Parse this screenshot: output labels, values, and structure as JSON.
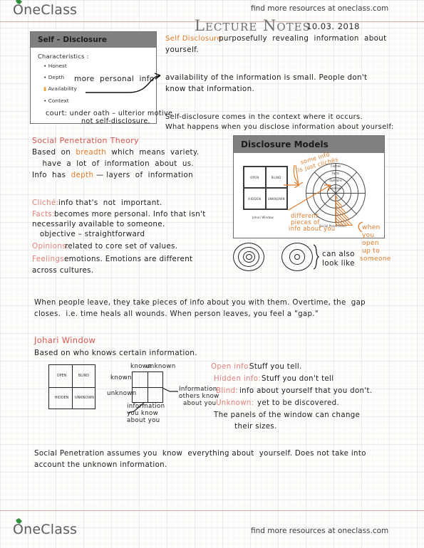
{
  "brand": {
    "name": "OneClass",
    "tagline": "find more resources at oneclass.com"
  },
  "header": {
    "title": "Lecture Notes",
    "date": "10.03. 2018"
  },
  "slides": [
    {
      "id": "self-disclosure",
      "title": "Self – Disclosure",
      "bullets": [
        "Characteristics :",
        "Honest",
        "Depth",
        "Availability",
        "Context"
      ],
      "annotations": [
        "more  personal  info",
        "court: under oath – ulterior motive",
        "not self-disclosure."
      ]
    },
    {
      "id": "disclosure-models",
      "title": "Disclosure Models",
      "johari": {
        "caption": "Johari Window",
        "cells": [
          "OPEN",
          "BLIND",
          "HIDDEN",
          "UNKNOWN"
        ]
      },
      "wheel": {
        "caption": "Social Penetration",
        "rings": [
          "Clichés",
          "Facts",
          "Opinions",
          "Feelings"
        ]
      },
      "annotations": [
        "some info",
        "is just clichés",
        "different",
        "pieces of",
        "info about you",
        "when",
        "you",
        "open",
        "up to",
        "someone"
      ]
    }
  ],
  "notes": {
    "col_right_top": [
      "Self Disclosure: purposefully revealing information about",
      "yourself."
    ],
    "availability": [
      "availability of the information is small. People don't",
      "know that information."
    ],
    "context": [
      "Self-disclosure comes in the context where it occurs.",
      "What happens when you disclose information about yourself:"
    ],
    "social_penetration": {
      "heading": "Social Penetration Theory",
      "lines": [
        "Based on breadth which means variety.",
        "   have a lot of information about us.",
        "Info has depth – layers of information"
      ],
      "highlight_breadth": "breadth",
      "highlight_depth": "depth"
    },
    "layers": [
      {
        "label": "Cliché:",
        "text": "info that's  not  important."
      },
      {
        "label": "Facts:",
        "text": "becomes more personal. Info that isn't"
      },
      {
        "label": "",
        "text": "necessarily available to someone."
      },
      {
        "label": "",
        "text": "   objective – straightforward"
      },
      {
        "label": "Opinions:",
        "text": "related to core set of values."
      },
      {
        "label": "Feelings:",
        "text": "emotions. Emotions are different"
      },
      {
        "label": "",
        "text": "across cultures."
      }
    ],
    "diagram_note": [
      "can also",
      "look like"
    ],
    "gap_paragraph": [
      "When people leave, they take pieces of info about you with them. Overtime, the  gap",
      "closes.  i.e. time heals all wounds. When person leaves, you feel a \"gap.\""
    ],
    "johari_section": {
      "heading": "Johari Window",
      "subheading": "Based on who knows certain information.",
      "drawing_labels": {
        "top_left": "known",
        "top_right": "unknown",
        "left_top": "known",
        "left_bottom": "unknown",
        "note_right": [
          "Information",
          "others know",
          "about you"
        ],
        "note_bottom": [
          "information",
          "you know",
          "about you"
        ]
      },
      "definitions": [
        {
          "label": "Open info:",
          "text": "Stuff you tell."
        },
        {
          "label": "Hidden info:",
          "text": "Stuff you don't tell"
        },
        {
          "label": "Blind:",
          "text": "info about yourself that you don't."
        },
        {
          "label": "Unknown:",
          "text": "yet to be discovered."
        }
      ],
      "closing": [
        "The panels of the window can change",
        "  their sizes."
      ]
    },
    "final_paragraph": [
      "Social Penetration assumes you  know  everything about  yourself. Does not take into",
      "account the unknown information."
    ]
  },
  "colors": {
    "red": "#d8544f",
    "orange": "#e07b2a",
    "pink": "#e2817c",
    "ink": "#20201f",
    "slide_header": "#808080",
    "rule": "#c98f8c",
    "brand_gray": "#5d5d5d",
    "leaf_green": "#2f8f3e"
  }
}
